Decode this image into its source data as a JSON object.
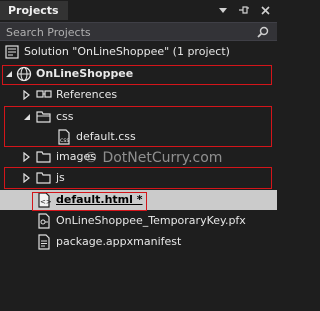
{
  "panel": {
    "title": "Projects"
  },
  "search": {
    "placeholder": "Search Projects"
  },
  "tree": {
    "solution": "Solution \"OnLineShoppee\" (1 project)",
    "project": "OnLineShoppee",
    "references": "References",
    "css_folder": "css",
    "css_file": "default.css",
    "images_folder": "images",
    "js_folder": "js",
    "html_file": "default.html *",
    "key_file": "OnLineShoppee_TemporaryKey.pfx",
    "manifest_file": "package.appxmanifest"
  },
  "watermark": "© DotNetCurry.com",
  "colors": {
    "selection": "#cbcbcb",
    "highlight_border": "#d4151a",
    "background": "#1e1e1e"
  }
}
